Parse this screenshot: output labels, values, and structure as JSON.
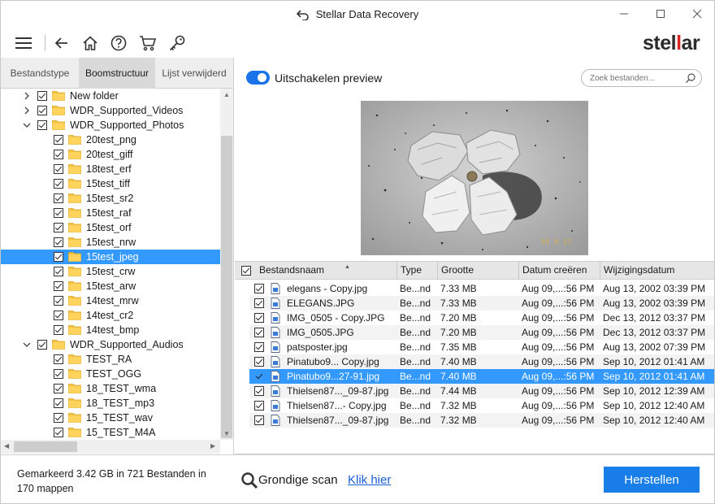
{
  "window": {
    "title": "Stellar Data Recovery",
    "brand_part1": "stel",
    "brand_part2": "l",
    "brand_part3": "ar"
  },
  "tabs": [
    {
      "label": "Bestandstype"
    },
    {
      "label": "Boomstructuur"
    },
    {
      "label": "Lijst verwijderd"
    }
  ],
  "tree": [
    {
      "label": "New folder",
      "expanded": false,
      "level": 1,
      "checked": true
    },
    {
      "label": "WDR_Supported_Videos",
      "expanded": false,
      "level": 1,
      "checked": true
    },
    {
      "label": "WDR_Supported_Photos",
      "expanded": true,
      "level": 1,
      "checked": true
    },
    {
      "label": "20test_png",
      "level": 2,
      "checked": true
    },
    {
      "label": "20test_giff",
      "level": 2,
      "checked": true
    },
    {
      "label": "18test_erf",
      "level": 2,
      "checked": true
    },
    {
      "label": "15test_tiff",
      "level": 2,
      "checked": true
    },
    {
      "label": "15test_sr2",
      "level": 2,
      "checked": true
    },
    {
      "label": "15test_raf",
      "level": 2,
      "checked": true
    },
    {
      "label": "15test_orf",
      "level": 2,
      "checked": true
    },
    {
      "label": "15test_nrw",
      "level": 2,
      "checked": true
    },
    {
      "label": "15test_jpeg",
      "level": 2,
      "checked": true,
      "selected": true
    },
    {
      "label": "15test_crw",
      "level": 2,
      "checked": true
    },
    {
      "label": "15test_arw",
      "level": 2,
      "checked": true
    },
    {
      "label": "14test_mrw",
      "level": 2,
      "checked": true
    },
    {
      "label": "14test_cr2",
      "level": 2,
      "checked": true
    },
    {
      "label": "14test_bmp",
      "level": 2,
      "checked": true
    },
    {
      "label": "WDR_Supported_Audios",
      "expanded": true,
      "level": 1,
      "checked": true
    },
    {
      "label": "TEST_RA",
      "level": 2,
      "checked": true
    },
    {
      "label": "TEST_OGG",
      "level": 2,
      "checked": true
    },
    {
      "label": "18_TEST_wma",
      "level": 2,
      "checked": true
    },
    {
      "label": "18_TEST_mp3",
      "level": 2,
      "checked": true
    },
    {
      "label": "15_TEST_wav",
      "level": 2,
      "checked": true
    },
    {
      "label": "15_TEST_M4A",
      "level": 2,
      "checked": true
    }
  ],
  "preview_toggle": {
    "label": "Uitschakelen preview",
    "on": true
  },
  "search": {
    "placeholder": "Zoek bestanden..."
  },
  "preview_image": {
    "date_stamp": "91 6 27"
  },
  "columns": [
    "Bestandsnaam",
    "Type",
    "Grootte",
    "Datum creëren",
    "Wijzigingsdatum"
  ],
  "files": [
    {
      "name": "elegans - Copy.jpg",
      "type": "Be...nd",
      "size": "7.33 MB",
      "created": "Aug 09,...:56 PM",
      "modified": "Aug 13, 2002 03:39 PM"
    },
    {
      "name": "ELEGANS.JPG",
      "type": "Be...nd",
      "size": "7.33 MB",
      "created": "Aug 09,...:56 PM",
      "modified": "Aug 13, 2002 03:39 PM"
    },
    {
      "name": "IMG_0505 - Copy.JPG",
      "type": "Be...nd",
      "size": "7.20 MB",
      "created": "Aug 09,...:56 PM",
      "modified": "Dec 13, 2012 03:37 PM"
    },
    {
      "name": "IMG_0505.JPG",
      "type": "Be...nd",
      "size": "7.20 MB",
      "created": "Aug 09,...:56 PM",
      "modified": "Dec 13, 2012 03:37 PM"
    },
    {
      "name": "patsposter.jpg",
      "type": "Be...nd",
      "size": "7.35 MB",
      "created": "Aug 09,...:56 PM",
      "modified": "Aug 13, 2002 07:39 PM"
    },
    {
      "name": "Pinatubo9... Copy.jpg",
      "type": "Be...nd",
      "size": "7.40 MB",
      "created": "Aug 09,...:56 PM",
      "modified": "Sep 10, 2012 01:41 AM"
    },
    {
      "name": "Pinatubo9...27-91.jpg",
      "type": "Be...nd",
      "size": "7.40 MB",
      "created": "Aug 09,...:56 PM",
      "modified": "Sep 10, 2012 01:41 AM",
      "selected": true
    },
    {
      "name": "Thielsen87..._09-87.jpg",
      "type": "Be...nd",
      "size": "7.44 MB",
      "created": "Aug 09,...:56 PM",
      "modified": "Sep 10, 2012 12:39 AM"
    },
    {
      "name": "Thielsen87...- Copy.jpg",
      "type": "Be...nd",
      "size": "7.32 MB",
      "created": "Aug 09,...:56 PM",
      "modified": "Sep 10, 2012 12:40 AM"
    },
    {
      "name": "Thielsen87..._09-87.jpg",
      "type": "Be...nd",
      "size": "7.32 MB",
      "created": "Aug 09,...:56 PM",
      "modified": "Sep 10, 2012 12:40 AM"
    }
  ],
  "footer": {
    "status": "Gemarkeerd 3.42 GB in 721 Bestanden in 170 mappen",
    "deep_scan_label": "Grondige scan",
    "deep_scan_link": "Klik hier",
    "recover_label": "Herstellen"
  },
  "colors": {
    "accent": "#1a7ee8",
    "selection": "#3399ff",
    "folder": "#f5c242",
    "brand_red": "#d6231f"
  },
  "icons": [
    "undo-icon",
    "minimize-icon",
    "maximize-icon",
    "close-icon",
    "menu-icon",
    "back-icon",
    "home-icon",
    "help-icon",
    "cart-icon",
    "key-icon",
    "search-icon",
    "folder-icon",
    "file-icon",
    "magnifier-icon"
  ]
}
